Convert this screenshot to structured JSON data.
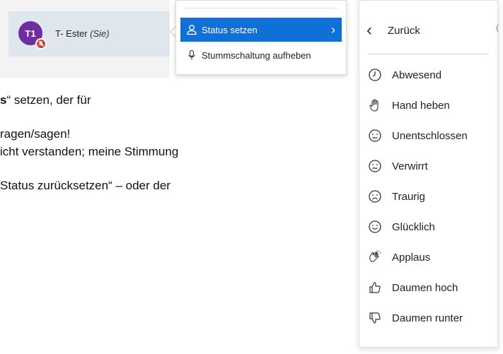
{
  "document": {
    "line1_bold": "s",
    "line1_rest": "“ setzen, der für",
    "line2": "ragen/sagen!",
    "line3": "icht verstanden; meine Stimmung",
    "line4": "Status zurücksetzen“ – oder der"
  },
  "user": {
    "initials": "T1",
    "name": "T- Ester",
    "self_tag": "(Sie)",
    "avatar_color": "#6f2ea0",
    "badge_color": "#d23b2f"
  },
  "menu1": {
    "items": [
      {
        "label": "Status setzen",
        "icon": "user-icon",
        "active": true
      },
      {
        "label": "Stummschaltung aufheben",
        "icon": "microphone-icon",
        "active": false
      }
    ],
    "accent": "#0f70d7"
  },
  "menu2": {
    "back_label": "Zurück",
    "edge_glyph": "(",
    "items": [
      {
        "label": "Abwesend",
        "icon": "clock-icon"
      },
      {
        "label": "Hand heben",
        "icon": "hand-icon"
      },
      {
        "label": "Unentschlossen",
        "icon": "neutral-face-icon"
      },
      {
        "label": "Verwirrt",
        "icon": "confused-face-icon"
      },
      {
        "label": "Traurig",
        "icon": "sad-face-icon"
      },
      {
        "label": "Glücklich",
        "icon": "happy-face-icon"
      },
      {
        "label": "Applaus",
        "icon": "clapping-hands-icon"
      },
      {
        "label": "Daumen hoch",
        "icon": "thumbs-up-icon"
      },
      {
        "label": "Daumen runter",
        "icon": "thumbs-down-icon"
      }
    ]
  }
}
